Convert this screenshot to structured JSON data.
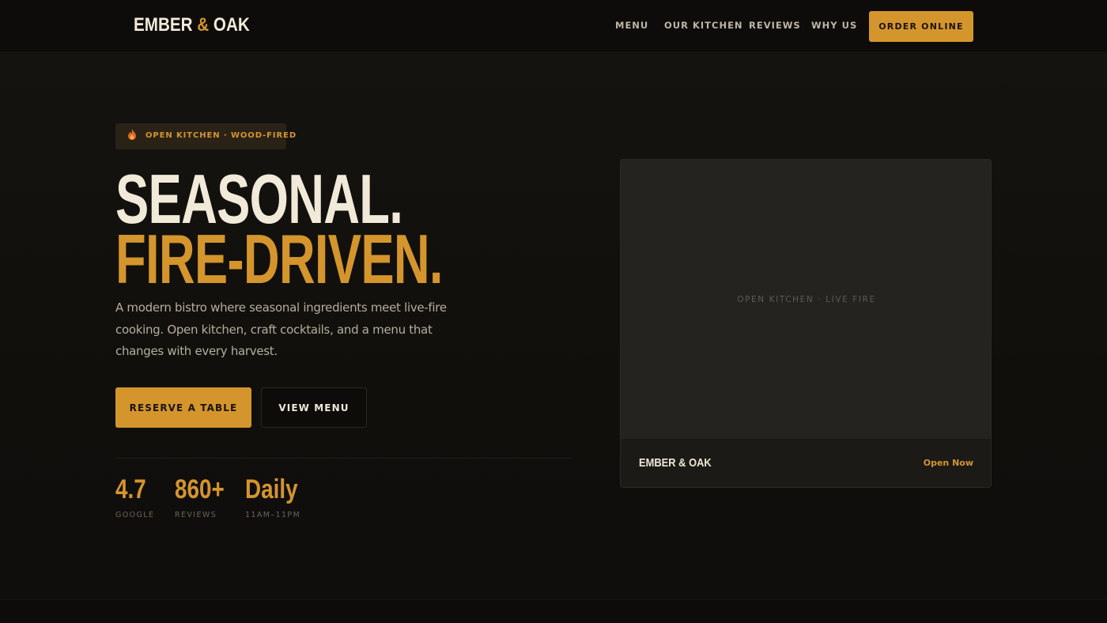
{
  "header": {
    "logo_pre": "EMBER ",
    "logo_amp": "&",
    "logo_post": " OAK",
    "nav": [
      "MENU",
      "OUR KITCHEN",
      "REVIEWS",
      "WHY US"
    ],
    "order_label": "ORDER ONLINE"
  },
  "hero": {
    "badge_icon": "flame-icon",
    "badge_text": "OPEN KITCHEN · WOOD-FIRED",
    "title_line1": "SEASONAL.",
    "title_line2": "FIRE-DRIVEN.",
    "description": "A modern bistro where seasonal ingredients meet live-fire cooking. Open kitchen, craft cocktails, and a menu that changes with every harvest.",
    "primary_cta": "RESERVE A TABLE",
    "secondary_cta": "VIEW MENU",
    "stats": [
      {
        "value": "4.7",
        "label": "GOOGLE"
      },
      {
        "value": "860+",
        "label": "REVIEWS"
      },
      {
        "value": "Daily",
        "label": "11AM–11PM"
      }
    ]
  },
  "card": {
    "image_label": "OPEN KITCHEN · LIVE FIRE",
    "name": "EMBER & OAK",
    "status": "Open Now"
  },
  "colors": {
    "accent": "#d4952d",
    "background": "#0f0e0c",
    "text": "#f1ead9"
  }
}
